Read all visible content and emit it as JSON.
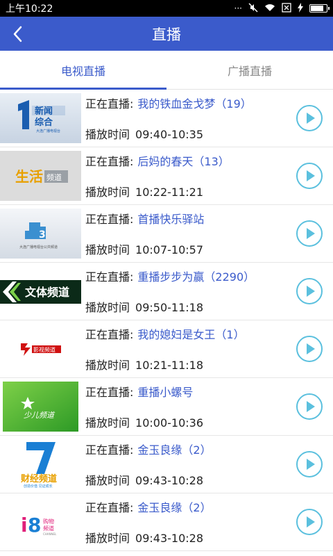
{
  "status_bar": {
    "time": "上午10:22"
  },
  "app_bar": {
    "title": "直播"
  },
  "tabs": [
    {
      "label": "电视直播",
      "active": true
    },
    {
      "label": "广播直播",
      "active": false
    }
  ],
  "colors": {
    "accent": "#3b5bcb",
    "play": "#5bc0de"
  },
  "channels": [
    {
      "logo": "channel-1-news-logo",
      "live_label": "正在直播:",
      "program": "我的铁血金戈梦（19）",
      "time_label": "播放时间",
      "time": "09:40-10:35"
    },
    {
      "logo": "life-channel-logo",
      "live_label": "正在直播:",
      "program": "后妈的春天（13）",
      "time_label": "播放时间",
      "time": "10:22-11:21"
    },
    {
      "logo": "channel-3-public-logo",
      "live_label": "正在直播:",
      "program": "首播快乐驿站",
      "time_label": "播放时间",
      "time": "10:07-10:57"
    },
    {
      "logo": "sports-channel-logo",
      "live_label": "正在直播:",
      "program": "重播步步为赢（2290）",
      "time_label": "播放时间",
      "time": "09:50-11:18"
    },
    {
      "logo": "film-channel-logo",
      "live_label": "正在直播:",
      "program": "我的媳妇是女王（1）",
      "time_label": "播放时间",
      "time": "10:21-11:18"
    },
    {
      "logo": "kids-channel-logo",
      "live_label": "正在直播:",
      "program": "重播小螺号",
      "time_label": "播放时间",
      "time": "10:00-10:36"
    },
    {
      "logo": "finance-channel-logo",
      "live_label": "正在直播:",
      "program": "金玉良缘（2）",
      "time_label": "播放时间",
      "time": "09:43-10:28"
    },
    {
      "logo": "shopping-channel-logo",
      "live_label": "正在直播:",
      "program": "金玉良缘（2）",
      "time_label": "播放时间",
      "time": "09:43-10:28"
    }
  ]
}
